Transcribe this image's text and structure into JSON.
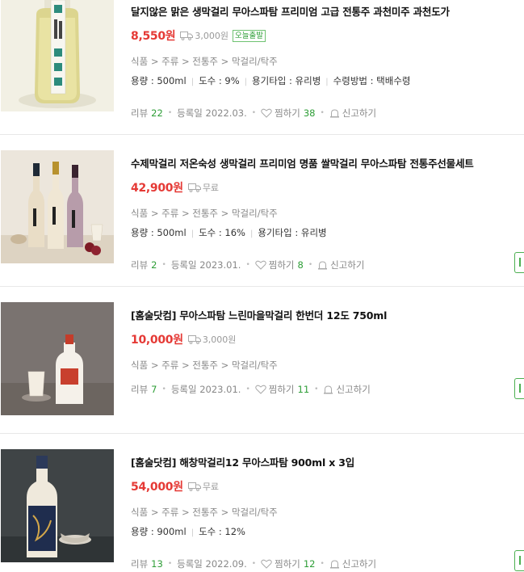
{
  "products": [
    {
      "title": "달지않은 맑은 생막걸리 무아스파탐 프리미엄 고급 전통주 과천미주 과천도가",
      "price": "8,550원",
      "shipping": "3,000원",
      "badge": "오늘출발",
      "category": [
        "식품",
        "주류",
        "전통주",
        "막걸리/탁주"
      ],
      "specs": [
        "용량 : 500ml",
        "도수 : 9%",
        "용기타입 : 유리병",
        "수령방법 : 택배수령"
      ],
      "review_label": "리뷰",
      "review_count": "22",
      "reg_label": "등록일",
      "reg_date": "2022.03.",
      "wish_label": "찜하기",
      "wish_count": "38",
      "report_label": "신고하기",
      "image_icon": "yellow-makgeolli-bottle-image"
    },
    {
      "title": "수제막걸리 저온숙성 생막걸리 프리미엄 명품 쌀막걸리 무아스파탐 전통주선물세트",
      "price": "42,900원",
      "shipping": "무료",
      "category": [
        "식품",
        "주류",
        "전통주",
        "막걸리/탁주"
      ],
      "specs": [
        "용량 : 500ml",
        "도수 : 16%",
        "용기타입 : 유리병"
      ],
      "review_label": "리뷰",
      "review_count": "2",
      "reg_label": "등록일",
      "reg_date": "2023.01.",
      "wish_label": "찜하기",
      "wish_count": "8",
      "report_label": "신고하기",
      "image_icon": "three-bottles-gift-set-image"
    },
    {
      "title": "[홈술닷컴] 무아스파탐 느린마을막걸리 한번더 12도 750ml",
      "price": "10,000원",
      "shipping": "3,000원",
      "category": [
        "식품",
        "주류",
        "전통주",
        "막걸리/탁주"
      ],
      "specs": [],
      "review_label": "리뷰",
      "review_count": "7",
      "reg_label": "등록일",
      "reg_date": "2023.01.",
      "wish_label": "찜하기",
      "wish_count": "11",
      "report_label": "신고하기",
      "image_icon": "white-bottle-with-glass-image"
    },
    {
      "title": "[홈술닷컴] 해창막걸리12 무아스파탐 900ml x 3입",
      "price": "54,000원",
      "shipping": "무료",
      "category": [
        "식품",
        "주류",
        "전통주",
        "막걸리/탁주"
      ],
      "specs": [
        "용량 : 900ml",
        "도수 : 12%"
      ],
      "review_label": "리뷰",
      "review_count": "13",
      "reg_label": "등록일",
      "reg_date": "2022.09.",
      "wish_label": "찜하기",
      "wish_count": "12",
      "report_label": "신고하기",
      "image_icon": "dark-label-bottle-with-bowl-image"
    }
  ]
}
